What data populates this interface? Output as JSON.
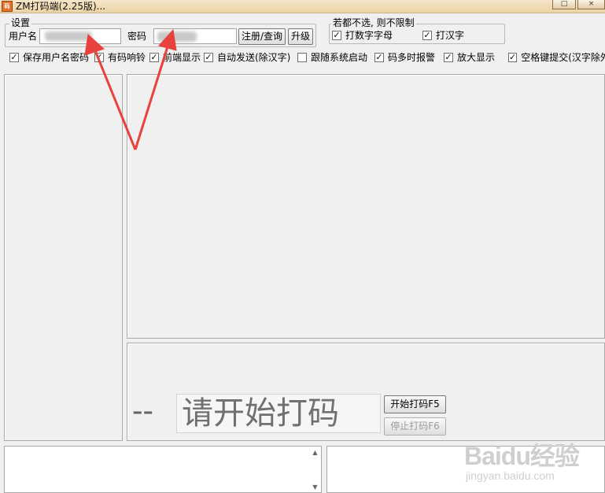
{
  "window": {
    "title": "ZM打码端(2.25版)...",
    "icon_text": "码",
    "close_glyph": "×",
    "maximize_glyph": "□"
  },
  "settings": {
    "group_label": "设置",
    "username_label": "用户名",
    "password_label": "密码",
    "username_value": "",
    "password_value": "",
    "register_button": "注册/查询",
    "upgrade_button": "升级"
  },
  "limits": {
    "group_label": "若都不选, 则不限制",
    "options": [
      {
        "label": "打数字字母",
        "checked": true
      },
      {
        "label": "打汉字",
        "checked": true
      }
    ]
  },
  "options": [
    {
      "label": "保存用户名密码",
      "checked": true
    },
    {
      "label": "有码响铃",
      "checked": true
    },
    {
      "label": "前端显示",
      "checked": true
    },
    {
      "label": "自动发送(除汉字)",
      "checked": true
    },
    {
      "label": "跟随系统启动",
      "checked": false
    },
    {
      "label": "码多时报警",
      "checked": true
    },
    {
      "label": "放大显示",
      "checked": true
    },
    {
      "label": "空格键提交(汉字除外)",
      "checked": true
    }
  ],
  "captcha": {
    "dashes": "--",
    "prompt": "请开始打码",
    "start_button": "开始打码F5",
    "stop_button": "停止打码F6"
  },
  "watermark": {
    "main": "Baidu经验",
    "sub": "jingyan.baidu.com"
  },
  "colors": {
    "annotation_arrow": "#e8423f"
  }
}
